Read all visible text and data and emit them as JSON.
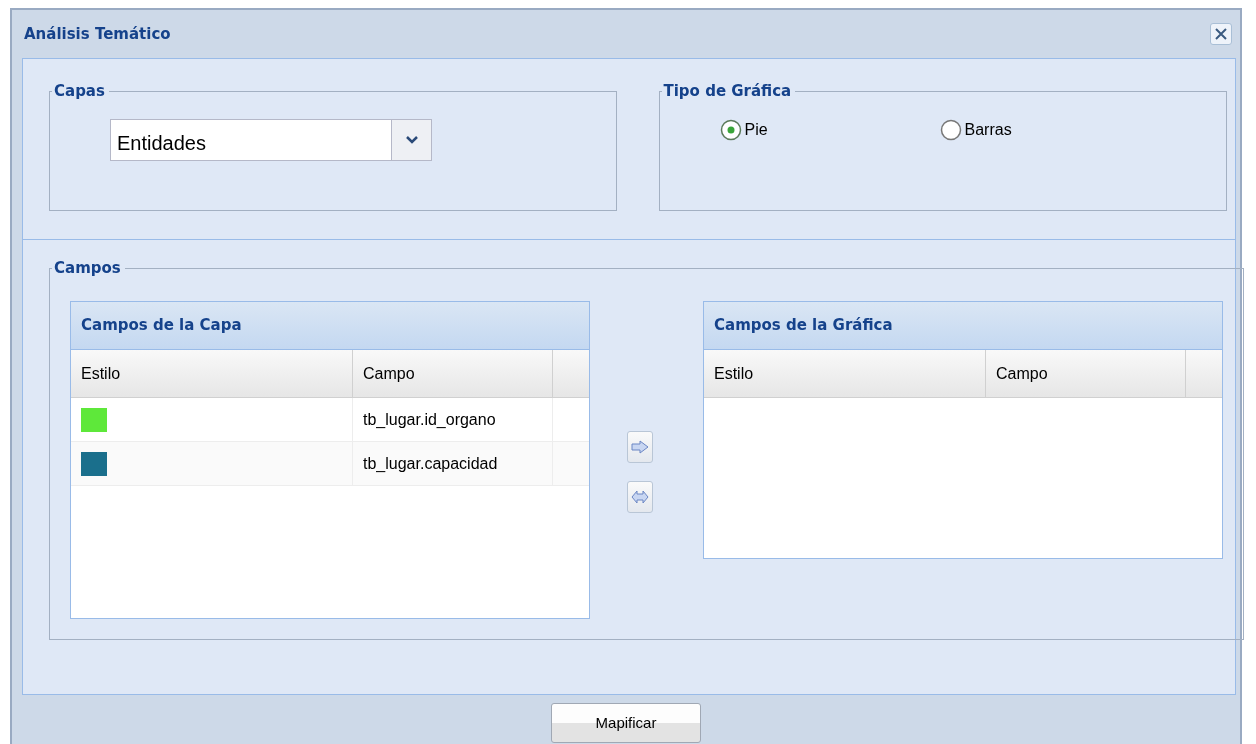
{
  "window": {
    "title": "Análisis Temático"
  },
  "layers": {
    "legend": "Capas",
    "value": "Entidades"
  },
  "chart_type": {
    "legend": "Tipo de Gráfica",
    "options": [
      {
        "label": "Pie",
        "selected": true
      },
      {
        "label": "Barras",
        "selected": false
      }
    ]
  },
  "fields": {
    "legend": "Campos",
    "layer_grid": {
      "title": "Campos de la Capa",
      "columns": [
        "Estilo",
        "Campo"
      ],
      "rows": [
        {
          "color": "#5ee83a",
          "field": "tb_lugar.id_organo"
        },
        {
          "color": "#1a6f8c",
          "field": "tb_lugar.capacidad"
        }
      ]
    },
    "chart_grid": {
      "title": "Campos de la Gráfica",
      "columns": [
        "Estilo",
        "Campo"
      ]
    }
  },
  "buttons": [
    "Mapificar"
  ]
}
